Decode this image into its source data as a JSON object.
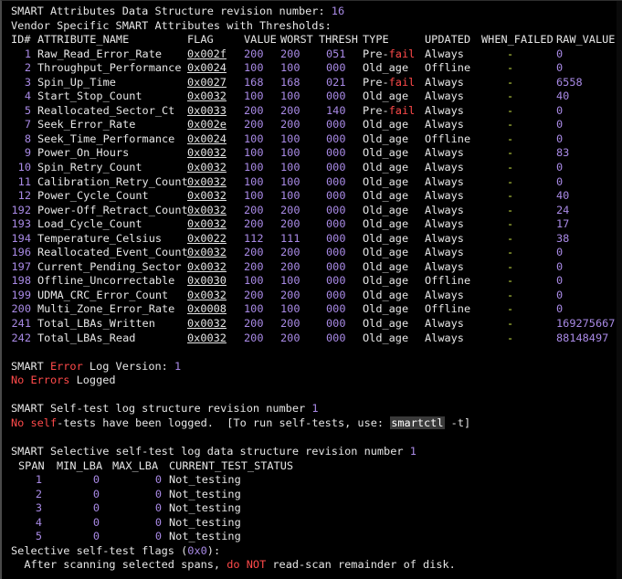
{
  "header": {
    "revision_label": "SMART Attributes Data Structure revision number: ",
    "revision_value": "16",
    "vendor_line": "Vendor Specific SMART Attributes with Thresholds:"
  },
  "columns": [
    "ID#",
    "ATTRIBUTE_NAME",
    "FLAG",
    "VALUE",
    "WORST",
    "THRESH",
    "TYPE",
    "UPDATED",
    "WHEN_FAILED",
    "RAW_VALUE"
  ],
  "attributes": [
    {
      "id": "1",
      "name": "Raw_Read_Error_Rate",
      "flag": "0x002f",
      "value": "200",
      "worst": "200",
      "thresh": "051",
      "type_a": "Pre-",
      "type_b": "fail",
      "updated": "Always",
      "when_failed": "-",
      "raw": "0"
    },
    {
      "id": "2",
      "name": "Throughput_Performance",
      "flag": "0x0024",
      "value": "100",
      "worst": "100",
      "thresh": "000",
      "type_a": "Old_age",
      "type_b": "",
      "updated": "Offline",
      "when_failed": "-",
      "raw": "0"
    },
    {
      "id": "3",
      "name": "Spin_Up_Time",
      "flag": "0x0027",
      "value": "168",
      "worst": "168",
      "thresh": "021",
      "type_a": "Pre-",
      "type_b": "fail",
      "updated": "Always",
      "when_failed": "-",
      "raw": "6558"
    },
    {
      "id": "4",
      "name": "Start_Stop_Count",
      "flag": "0x0032",
      "value": "100",
      "worst": "100",
      "thresh": "000",
      "type_a": "Old_age",
      "type_b": "",
      "updated": "Always",
      "when_failed": "-",
      "raw": "40"
    },
    {
      "id": "5",
      "name": "Reallocated_Sector_Ct",
      "flag": "0x0033",
      "value": "200",
      "worst": "200",
      "thresh": "140",
      "type_a": "Pre-",
      "type_b": "fail",
      "updated": "Always",
      "when_failed": "-",
      "raw": "0"
    },
    {
      "id": "7",
      "name": "Seek_Error_Rate",
      "flag": "0x002e",
      "value": "200",
      "worst": "200",
      "thresh": "000",
      "type_a": "Old_age",
      "type_b": "",
      "updated": "Always",
      "when_failed": "-",
      "raw": "0"
    },
    {
      "id": "8",
      "name": "Seek_Time_Performance",
      "flag": "0x0024",
      "value": "100",
      "worst": "100",
      "thresh": "000",
      "type_a": "Old_age",
      "type_b": "",
      "updated": "Offline",
      "when_failed": "-",
      "raw": "0"
    },
    {
      "id": "9",
      "name": "Power_On_Hours",
      "flag": "0x0032",
      "value": "100",
      "worst": "100",
      "thresh": "000",
      "type_a": "Old_age",
      "type_b": "",
      "updated": "Always",
      "when_failed": "-",
      "raw": "83"
    },
    {
      "id": "10",
      "name": "Spin_Retry_Count",
      "flag": "0x0032",
      "value": "100",
      "worst": "100",
      "thresh": "000",
      "type_a": "Old_age",
      "type_b": "",
      "updated": "Always",
      "when_failed": "-",
      "raw": "0"
    },
    {
      "id": "11",
      "name": "Calibration_Retry_Count",
      "flag": "0x0032",
      "value": "100",
      "worst": "100",
      "thresh": "000",
      "type_a": "Old_age",
      "type_b": "",
      "updated": "Always",
      "when_failed": "-",
      "raw": "0"
    },
    {
      "id": "12",
      "name": "Power_Cycle_Count",
      "flag": "0x0032",
      "value": "100",
      "worst": "100",
      "thresh": "000",
      "type_a": "Old_age",
      "type_b": "",
      "updated": "Always",
      "when_failed": "-",
      "raw": "40"
    },
    {
      "id": "192",
      "name": "Power-Off_Retract_Count",
      "flag": "0x0032",
      "value": "200",
      "worst": "200",
      "thresh": "000",
      "type_a": "Old_age",
      "type_b": "",
      "updated": "Always",
      "when_failed": "-",
      "raw": "24"
    },
    {
      "id": "193",
      "name": "Load_Cycle_Count",
      "flag": "0x0032",
      "value": "200",
      "worst": "200",
      "thresh": "000",
      "type_a": "Old_age",
      "type_b": "",
      "updated": "Always",
      "when_failed": "-",
      "raw": "17"
    },
    {
      "id": "194",
      "name": "Temperature_Celsius",
      "flag": "0x0022",
      "value": "112",
      "worst": "111",
      "thresh": "000",
      "type_a": "Old_age",
      "type_b": "",
      "updated": "Always",
      "when_failed": "-",
      "raw": "38"
    },
    {
      "id": "196",
      "name": "Reallocated_Event_Count",
      "flag": "0x0032",
      "value": "200",
      "worst": "200",
      "thresh": "000",
      "type_a": "Old_age",
      "type_b": "",
      "updated": "Always",
      "when_failed": "-",
      "raw": "0"
    },
    {
      "id": "197",
      "name": "Current_Pending_Sector",
      "flag": "0x0032",
      "value": "200",
      "worst": "200",
      "thresh": "000",
      "type_a": "Old_age",
      "type_b": "",
      "updated": "Always",
      "when_failed": "-",
      "raw": "0"
    },
    {
      "id": "198",
      "name": "Offline_Uncorrectable",
      "flag": "0x0030",
      "value": "100",
      "worst": "100",
      "thresh": "000",
      "type_a": "Old_age",
      "type_b": "",
      "updated": "Offline",
      "when_failed": "-",
      "raw": "0"
    },
    {
      "id": "199",
      "name": "UDMA_CRC_Error_Count",
      "flag": "0x0032",
      "value": "200",
      "worst": "200",
      "thresh": "000",
      "type_a": "Old_age",
      "type_b": "",
      "updated": "Always",
      "when_failed": "-",
      "raw": "0"
    },
    {
      "id": "200",
      "name": "Multi_Zone_Error_Rate",
      "flag": "0x0008",
      "value": "100",
      "worst": "100",
      "thresh": "000",
      "type_a": "Old_age",
      "type_b": "",
      "updated": "Offline",
      "when_failed": "-",
      "raw": "0"
    },
    {
      "id": "241",
      "name": "Total_LBAs_Written",
      "flag": "0x0032",
      "value": "200",
      "worst": "200",
      "thresh": "000",
      "type_a": "Old_age",
      "type_b": "",
      "updated": "Always",
      "when_failed": "-",
      "raw": "169275667"
    },
    {
      "id": "242",
      "name": "Total_LBAs_Read",
      "flag": "0x0032",
      "value": "200",
      "worst": "200",
      "thresh": "000",
      "type_a": "Old_age",
      "type_b": "",
      "updated": "Always",
      "when_failed": "-",
      "raw": "88148497"
    }
  ],
  "error_log": {
    "version_a": "SMART ",
    "version_error": "Error",
    "version_b": " Log Version: ",
    "version_value": "1",
    "no_word": "No ",
    "errors_word": "Errors",
    "logged_word": " Logged"
  },
  "selftest_log": {
    "revision_label": "SMART Self-test log structure revision number ",
    "revision_value": "1",
    "no_a": "No ",
    "self_word": "self",
    "no_b": "-tests have been logged.  [To run self-tests, use: ",
    "command": "smartctl",
    "flag": " -t",
    "close": "]"
  },
  "selective_log": {
    "revision_label": "SMART Selective self-test log data structure revision number ",
    "revision_value": "1",
    "columns": [
      "SPAN",
      "MIN_LBA",
      "MAX_LBA",
      "CURRENT_TEST_STATUS"
    ],
    "rows": [
      {
        "span": "1",
        "min": "0",
        "max": "0",
        "status": "Not_testing"
      },
      {
        "span": "2",
        "min": "0",
        "max": "0",
        "status": "Not_testing"
      },
      {
        "span": "3",
        "min": "0",
        "max": "0",
        "status": "Not_testing"
      },
      {
        "span": "4",
        "min": "0",
        "max": "0",
        "status": "Not_testing"
      },
      {
        "span": "5",
        "min": "0",
        "max": "0",
        "status": "Not_testing"
      }
    ],
    "flags_a": "Selective self-test flags (",
    "flags_value": "0x0",
    "flags_b": "):",
    "after_a": "  After scanning selected spans, ",
    "after_do": "do",
    "after_sp": " ",
    "after_not": "NOT",
    "after_b": " read-scan remainder of disk."
  },
  "colors": {
    "background": "#000000",
    "text": "#e6e6e6",
    "number": "#a98ae6",
    "error": "#ff4a4a",
    "dash": "#d6f04a"
  }
}
